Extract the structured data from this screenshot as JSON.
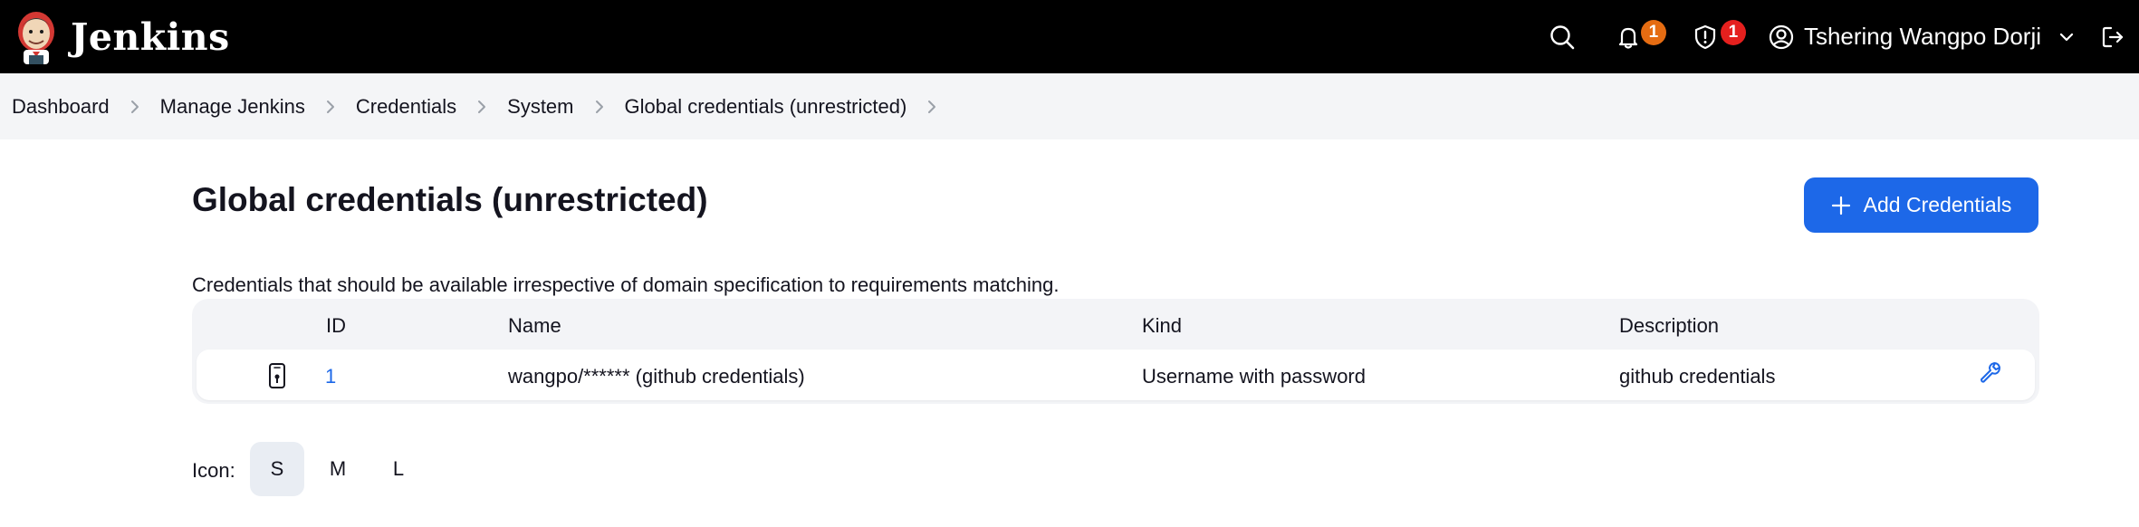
{
  "header": {
    "app_name": "Jenkins",
    "notifications_count": "1",
    "security_count": "1",
    "user_name": "Tshering Wangpo Dorji",
    "colors": {
      "background": "#000000",
      "notification_badge": "#e56c12",
      "security_badge": "#e5201e"
    }
  },
  "breadcrumb": {
    "items": [
      {
        "label": "Dashboard"
      },
      {
        "label": "Manage Jenkins"
      },
      {
        "label": "Credentials"
      },
      {
        "label": "System"
      },
      {
        "label": "Global credentials (unrestricted)"
      }
    ]
  },
  "main": {
    "title": "Global credentials (unrestricted)",
    "add_button_label": "Add Credentials",
    "description": "Credentials that should be available irrespective of domain specification to requirements matching.",
    "accent_color": "#1d68e8"
  },
  "table": {
    "headers": {
      "id": "ID",
      "name": "Name",
      "kind": "Kind",
      "description": "Description"
    },
    "rows": [
      {
        "icon": "mobile-key-icon",
        "id": "1",
        "name": "wangpo/****** (github credentials)",
        "kind": "Username with password",
        "description": "github credentials",
        "action_icon": "wrench-icon"
      }
    ]
  },
  "icon_size": {
    "label": "Icon:",
    "options": [
      "S",
      "M",
      "L"
    ],
    "selected": "S"
  }
}
